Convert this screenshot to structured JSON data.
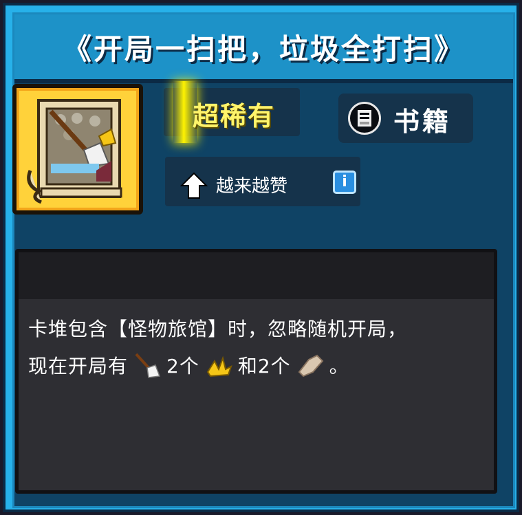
{
  "card": {
    "title": "《开局一扫把，垃圾全打扫》",
    "icon": "broom-scroll-card-icon",
    "rarity": "超稀有",
    "rarity_color": "#fff46a",
    "category": {
      "icon": "book-icon",
      "label": "书籍"
    },
    "upgrade": {
      "icon": "up-arrow-icon",
      "label": "越来越赞",
      "info_icon": "i"
    },
    "description": {
      "line1": "卡堆包含【怪物旅馆】时，忽略随机开局，",
      "line2_part1": "现在开局有",
      "item1_icon": "broom-icon",
      "item1_count": "2个",
      "item2_icon": "banana-peel-icon",
      "line2_part2": "和2个",
      "item3_icon": "old-paper-icon",
      "line2_end": "。"
    }
  },
  "colors": {
    "frame": "#27b1ea",
    "panel": "#0f4365",
    "desc_bg": "#2e2e33",
    "card_gold": "#ffd23a"
  }
}
